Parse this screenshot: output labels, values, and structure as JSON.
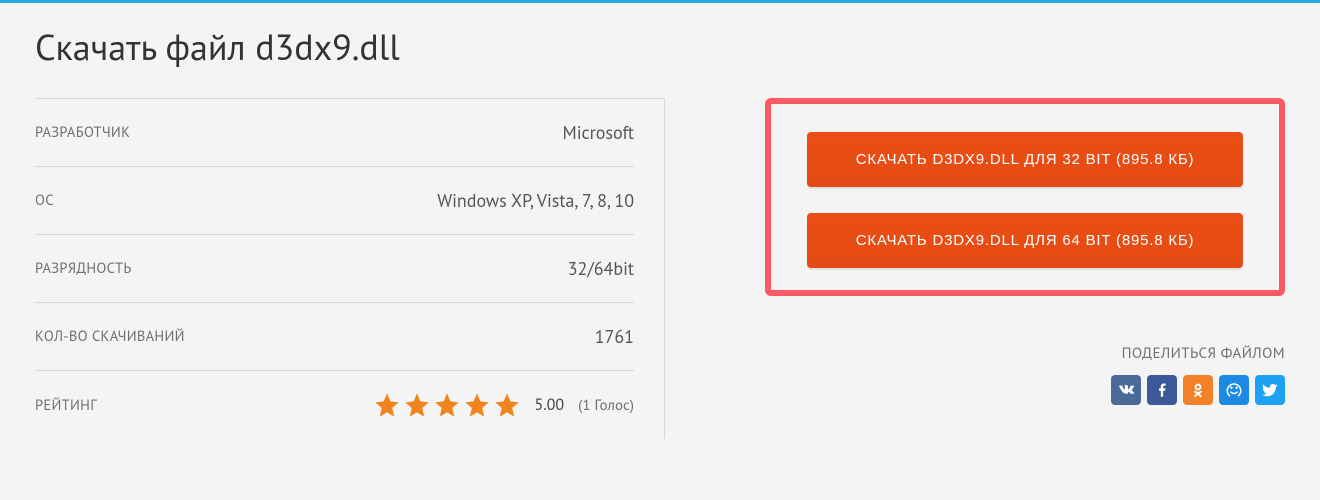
{
  "title": "Скачать файл d3dx9.dll",
  "info": {
    "developer_label": "РАЗРАБОТЧИК",
    "developer_value": "Microsoft",
    "os_label": "ОС",
    "os_value": "Windows XP, Vista, 7, 8, 10",
    "arch_label": "РАЗРЯДНОСТЬ",
    "arch_value": "32/64bit",
    "downloads_label": "КОЛ-ВО СКАЧИВАНИЙ",
    "downloads_value": "1761",
    "rating_label": "РЕЙТИНГ",
    "rating_score": "5.00",
    "rating_votes": "(1 Голос)",
    "rating_stars": 5
  },
  "downloads": {
    "btn32": "СКАЧАТЬ D3DX9.DLL ДЛЯ 32 BIT (895.8 КБ)",
    "btn64": "СКАЧАТЬ D3DX9.DLL ДЛЯ 64 BIT (895.8 КБ)"
  },
  "share": {
    "title": "ПОДЕЛИТЬСЯ ФАЙЛОМ",
    "networks": [
      "vk",
      "fb",
      "ok",
      "mm",
      "tw"
    ]
  },
  "colors": {
    "accent_border": "#fb5a62",
    "button": "#e74c15",
    "top_bar": "#2aa9df",
    "star": "#f0851f"
  }
}
